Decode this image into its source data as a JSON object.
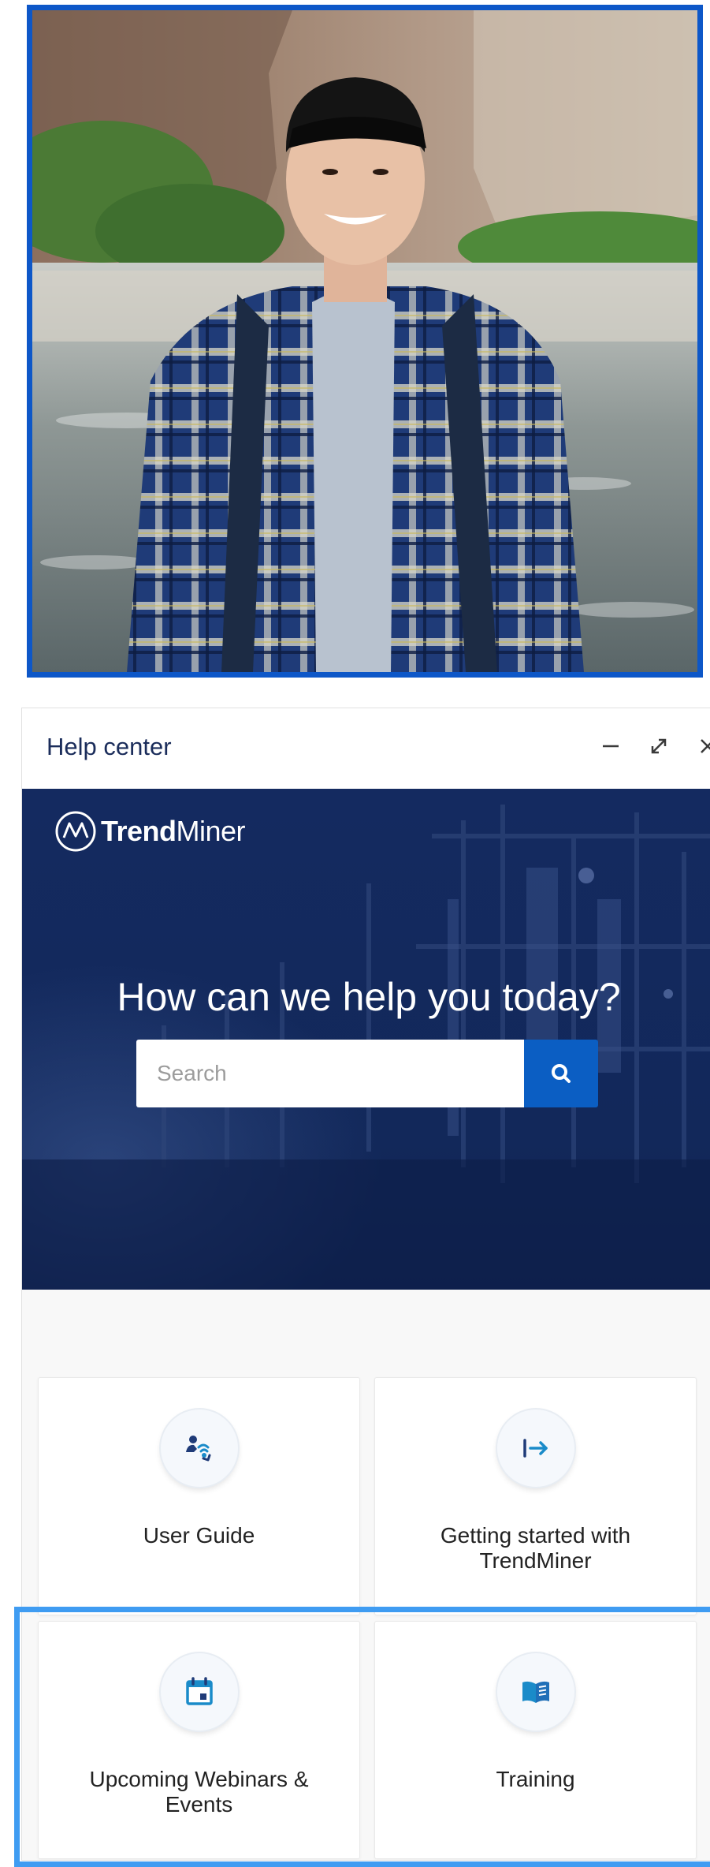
{
  "photo": {
    "frame_color": "#0d57c8",
    "subject": "smiling-young-man-photo"
  },
  "help_center": {
    "title": "Help center",
    "controls": {
      "minimize_icon": "minimize-icon",
      "expand_icon": "expand-icon",
      "close_icon": "close-icon"
    },
    "hero": {
      "brand_bold": "Trend",
      "brand_light": "Miner",
      "heading": "How can we help you today?",
      "search_placeholder": "Search",
      "search_value": "",
      "search_button_icon": "search-icon",
      "accent": "#0b5ec3",
      "background": "#13275a"
    },
    "cards": [
      {
        "label": "User Guide",
        "icon": "user-guide-icon"
      },
      {
        "label": "Getting started with TrendMiner",
        "icon": "arrow-right-to-icon"
      },
      {
        "label": "Upcoming Webinars & Events",
        "icon": "calendar-icon"
      },
      {
        "label": "Training",
        "icon": "book-icon"
      }
    ],
    "highlight_color": "#3f9cf2"
  }
}
